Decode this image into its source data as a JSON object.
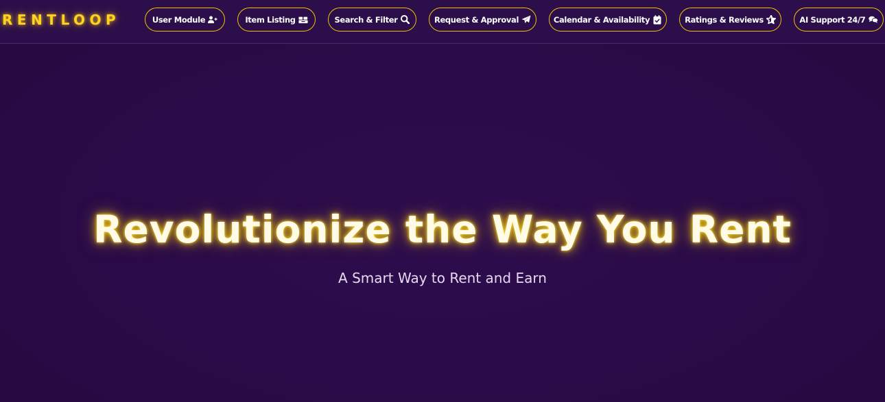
{
  "brand": {
    "name": "RENTLOOP",
    "color": "#ffd21f"
  },
  "nav": {
    "items": [
      {
        "label": "User Module",
        "icon": "user-plus-icon"
      },
      {
        "label": "Item Listing",
        "icon": "boxes-icon"
      },
      {
        "label": "Search & Filter",
        "icon": "search-icon"
      },
      {
        "label": "Request & Approval",
        "icon": "paper-plane-icon"
      },
      {
        "label": "Calendar & Availability",
        "icon": "calendar-check-icon"
      },
      {
        "label": "Ratings & Reviews",
        "icon": "star-icon"
      },
      {
        "label": "AI Support 24/7",
        "icon": "comments-icon"
      }
    ],
    "border_color": "#f2c200"
  },
  "hero": {
    "title": "Revolutionize the Way You Rent",
    "subtitle": "A Smart Way to Rent and Earn"
  },
  "colors": {
    "background": "#2a0b48",
    "accent": "#ffd21f"
  }
}
